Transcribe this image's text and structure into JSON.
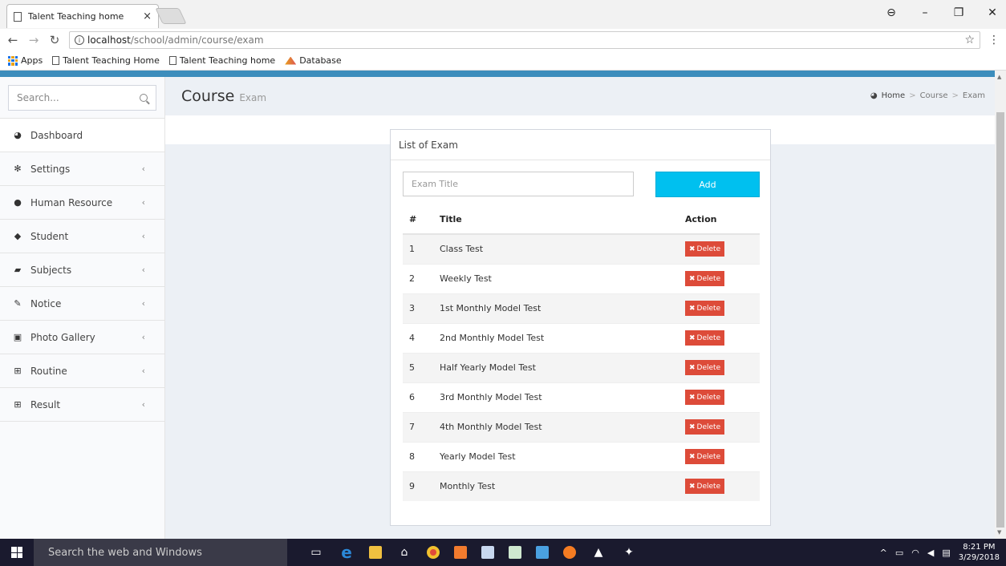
{
  "browser": {
    "tab_title": "Talent Teaching home",
    "tab_close": "×",
    "url_host": "localhost",
    "url_path": "/school/admin/course/exam",
    "bookmarks": [
      {
        "label": "Apps"
      },
      {
        "label": "Talent Teaching Home"
      },
      {
        "label": "Talent Teaching home"
      },
      {
        "label": "Database"
      }
    ]
  },
  "sidebar": {
    "search_placeholder": "Search...",
    "items": [
      {
        "label": "Dashboard",
        "icon": "dashboard-icon"
      },
      {
        "label": "Settings",
        "icon": "gear-icon"
      },
      {
        "label": "Human Resource",
        "icon": "user-icon"
      },
      {
        "label": "Student",
        "icon": "graduation-cap-icon"
      },
      {
        "label": "Subjects",
        "icon": "book-icon"
      },
      {
        "label": "Notice",
        "icon": "edit-icon"
      },
      {
        "label": "Photo Gallery",
        "icon": "image-icon"
      },
      {
        "label": "Routine",
        "icon": "table-icon"
      },
      {
        "label": "Result",
        "icon": "table-icon"
      }
    ]
  },
  "header": {
    "title": "Course",
    "subtitle": "Exam",
    "breadcrumb": [
      "Home",
      "Course",
      "Exam"
    ]
  },
  "exam_box": {
    "title": "List of Exam",
    "input_placeholder": "Exam Title",
    "add_label": "Add",
    "columns": [
      "#",
      "Title",
      "Action"
    ],
    "delete_label": "Delete",
    "rows": [
      {
        "num": "1",
        "title": "Class Test"
      },
      {
        "num": "2",
        "title": "Weekly Test"
      },
      {
        "num": "3",
        "title": "1st Monthly Model Test"
      },
      {
        "num": "4",
        "title": "2nd Monthly Model Test"
      },
      {
        "num": "5",
        "title": "Half Yearly Model Test"
      },
      {
        "num": "6",
        "title": "3rd Monthly Model Test"
      },
      {
        "num": "7",
        "title": "4th Monthly Model Test"
      },
      {
        "num": "8",
        "title": "Yearly Model Test"
      },
      {
        "num": "9",
        "title": "Monthly Test"
      }
    ]
  },
  "taskbar": {
    "search_text": "Search the web and Windows",
    "time": "8:21 PM",
    "date": "3/29/2018"
  },
  "colors": {
    "accent": "#3c8dbc",
    "add_button": "#00c0ef",
    "delete_button": "#dd4b39"
  }
}
